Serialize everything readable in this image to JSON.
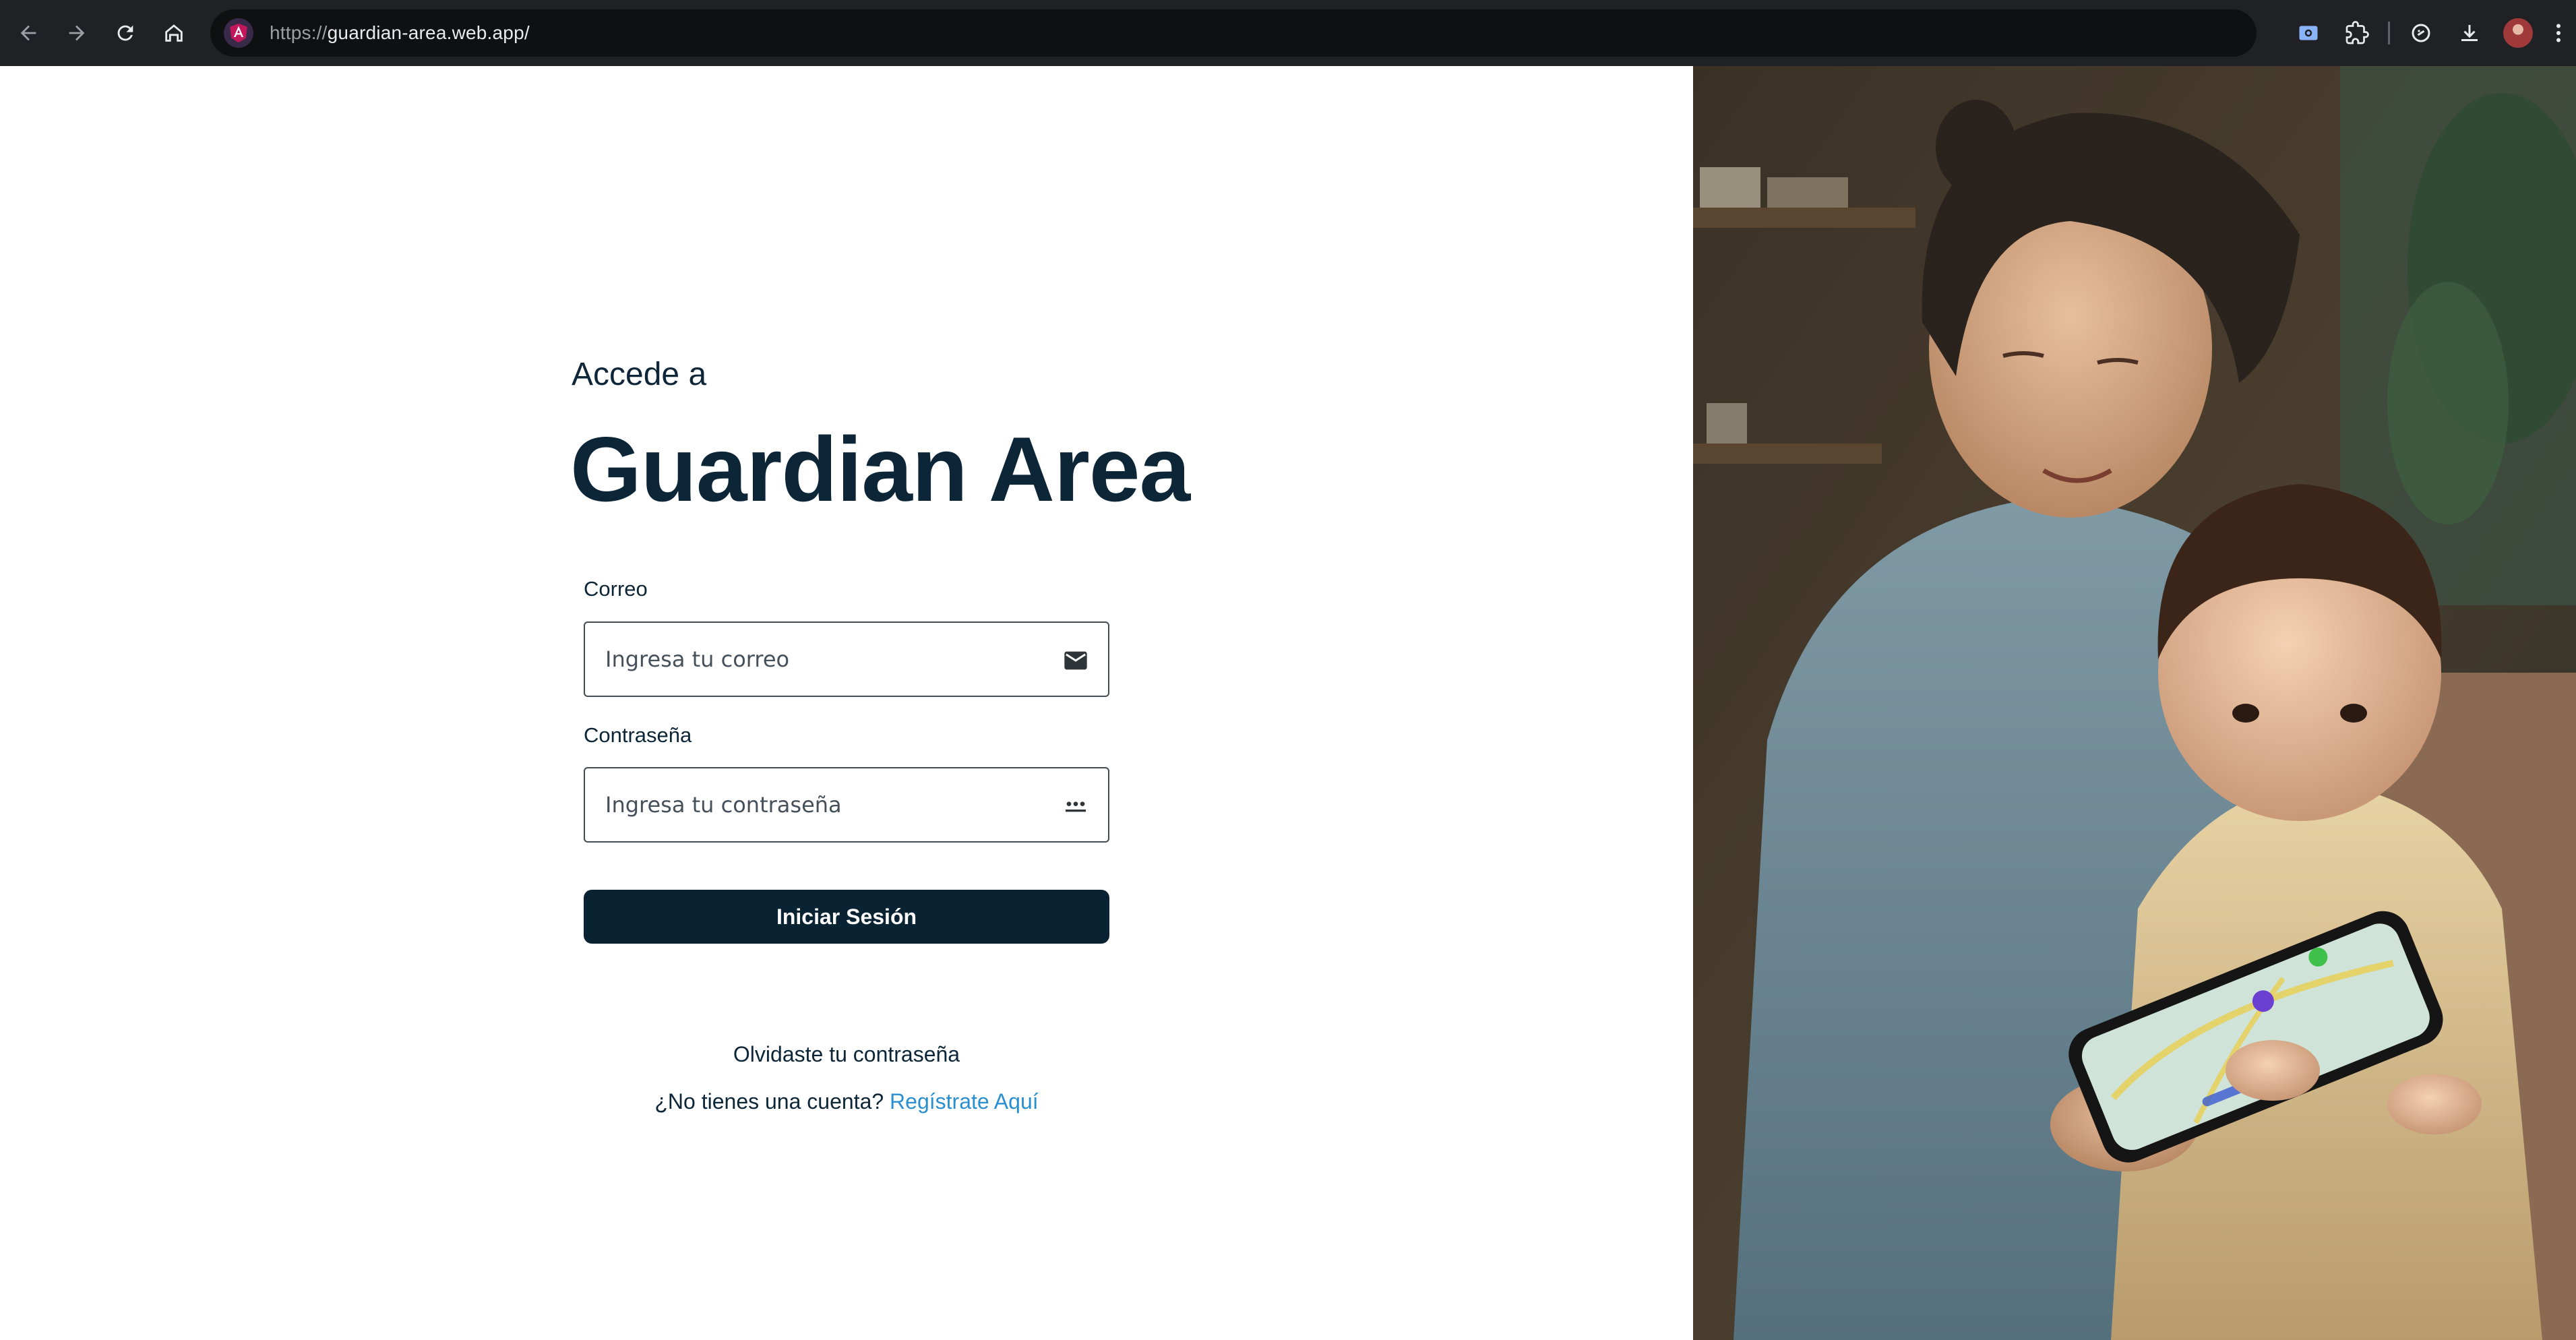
{
  "browser": {
    "url_protocol": "https://",
    "url_host": "guardian-area.web.app/"
  },
  "login": {
    "kicker": "Accede a",
    "brand": "Guardian Area",
    "email_label": "Correo",
    "email_placeholder": "Ingresa tu correo",
    "email_icon": "mail-icon",
    "password_label": "Contraseña",
    "password_placeholder": "Ingresa tu contraseña",
    "password_icon": "password-dots-icon",
    "submit_label": "Iniciar Sesión",
    "forgot_label": "Olvidaste tu contraseña",
    "signup_prompt": "¿No tienes una cuenta?",
    "signup_link": "Regístrate Aquí"
  },
  "colors": {
    "primary": "#0a2333",
    "link": "#2a8fd0",
    "chrome_bg": "#202124"
  }
}
